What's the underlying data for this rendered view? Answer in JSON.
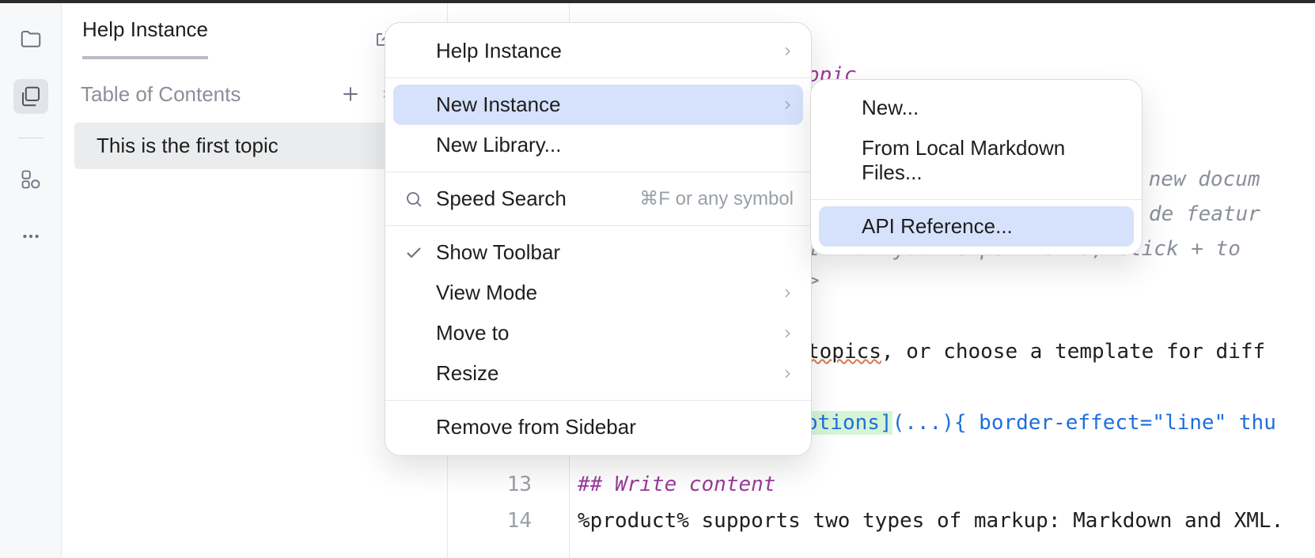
{
  "sidebar": {
    "tab_label": "Help Instance",
    "toc_label": "Table of Contents",
    "items": [
      {
        "label": "This is the first topic"
      }
    ]
  },
  "menu_main": [
    {
      "type": "item",
      "label": "Help Instance",
      "chevron": true
    },
    {
      "type": "sep"
    },
    {
      "type": "item",
      "label": "New Instance",
      "chevron": true,
      "hover": true
    },
    {
      "type": "item",
      "label": "New Library..."
    },
    {
      "type": "sep"
    },
    {
      "type": "item",
      "label": "Speed Search",
      "icon": "search",
      "shortcut": "⌘F or any symbol"
    },
    {
      "type": "sep"
    },
    {
      "type": "item",
      "label": "Show Toolbar",
      "icon": "check"
    },
    {
      "type": "item",
      "label": "View Mode",
      "chevron": true
    },
    {
      "type": "item",
      "label": "Move to",
      "chevron": true
    },
    {
      "type": "item",
      "label": "Resize",
      "chevron": true
    },
    {
      "type": "sep"
    },
    {
      "type": "item",
      "label": "Remove from Sidebar"
    }
  ],
  "menu_sub": [
    {
      "type": "item",
      "label": "New..."
    },
    {
      "type": "item",
      "label": "From Local Markdown Files..."
    },
    {
      "type": "sep"
    },
    {
      "type": "item",
      "label": "API Reference...",
      "hover": true
    }
  ],
  "editor": {
    "frag_topic": "opic",
    "frag_comment1a": " new docum",
    "frag_comment1b": "de featur",
    "frag_comment2": "it for your experiments, click + to ",
    "frag_gt": ">",
    "frag_topics_plain": ", or choose a template for diff",
    "frag_topics_wavy": "topics",
    "frag_link_text": "otions]",
    "frag_link_url": "(...)",
    "frag_link_attrs": "{ border-effect=\"line\" thu",
    "line13_no": "13",
    "line13_code": "## Write content",
    "line14_no": "14",
    "line14_code": "%product% supports two types of markup: Markdown and XML."
  }
}
